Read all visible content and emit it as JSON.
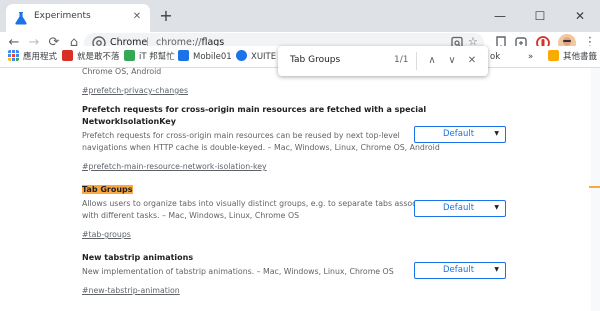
{
  "window": {
    "tab_title": "Experiments",
    "tab_close": "✕",
    "new_tab": "+",
    "minimize": "—",
    "maximize": "☐",
    "close": "✕"
  },
  "toolbar": {
    "back": "←",
    "forward": "→",
    "reload": "⟳",
    "home": "⌂",
    "scheme": "Chrome",
    "separator": "|",
    "url_host": "chrome://",
    "url_path": "flags",
    "star": "☆",
    "menu": "⋮"
  },
  "bookmarks": [
    {
      "label": "應用程式",
      "color": "#4285f4"
    },
    {
      "label": "就是敢不落",
      "color": "#d93025"
    },
    {
      "label": "iT 邦幫忙",
      "color": "#34a853"
    },
    {
      "label": "Mobile01",
      "color": "#1a73e8"
    },
    {
      "label": "XUITE",
      "color": "#1a73e8"
    },
    {
      "label": "ok",
      "color": ""
    },
    {
      "label": "»",
      "color": ""
    },
    {
      "label": "其他書籤",
      "color": "#f9ab00"
    }
  ],
  "find": {
    "query": "Tab Groups",
    "count": "1/1",
    "prev": "∧",
    "next": "∨",
    "close": "✕"
  },
  "experiments": [
    {
      "title": "",
      "desc_lines": [
        "Chrome OS, Android"
      ],
      "link": "#prefetch-privacy-changes",
      "select": ""
    },
    {
      "title_lines": [
        "Prefetch requests for cross-origin main resources are fetched with a special",
        "NetworkIsolationKey"
      ],
      "desc_lines": [
        "Prefetch requests for cross-origin main resources can be reused by next top-level",
        "navigations when HTTP cache is double-keyed. – Mac, Windows, Linux, Chrome OS, Android"
      ],
      "link": "#prefetch-main-resource-network-isolation-key",
      "select": "Default"
    },
    {
      "title": "Tab Groups",
      "desc_lines": [
        "Allows users to organize tabs into visually distinct groups, e.g. to separate tabs associated",
        "with different tasks. – Mac, Windows, Linux, Chrome OS"
      ],
      "link": "#tab-groups",
      "select": "Default"
    },
    {
      "title": "New tabstrip animations",
      "desc_lines": [
        "New implementation of tabstrip animations. – Mac, Windows, Linux, Chrome OS"
      ],
      "link": "#new-tabstrip-animation",
      "select": "Default"
    }
  ],
  "colors": {
    "accent": "#1a73e8",
    "highlight": "#f9a73e"
  }
}
